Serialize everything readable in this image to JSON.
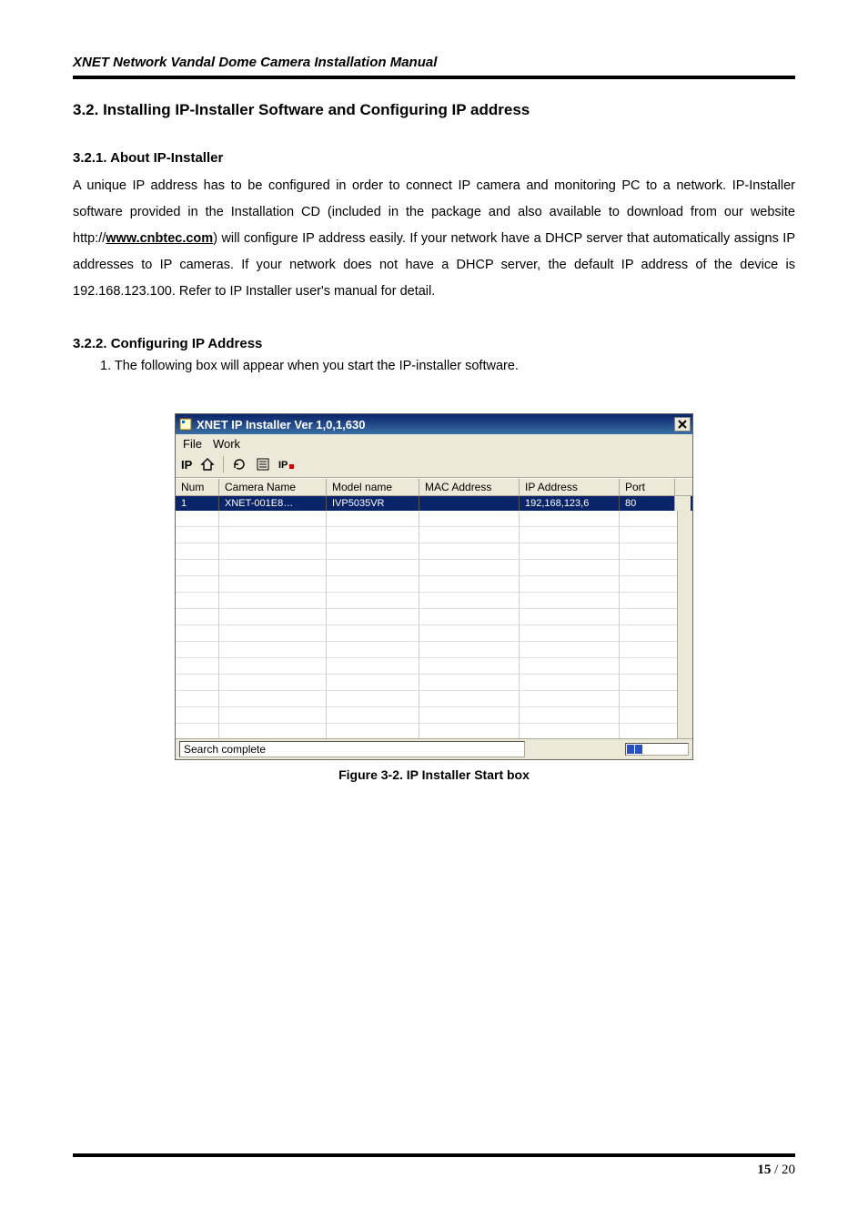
{
  "doc": {
    "header": "XNET Network Vandal Dome Camera Installation Manual",
    "section_title": "3.2. Installing IP-Installer Software and Configuring IP address",
    "sub1_title": "3.2.1. About IP-Installer",
    "para1_pre": "A unique IP address has to be configured in order to connect IP camera and monitoring PC to a network. IP-Installer software provided in the Installation CD (included in the package and also available to download from our website http://",
    "para1_link": "www.cnbtec.com",
    "para1_post": ") will configure IP address easily. If your network have a DHCP server that automatically assigns IP addresses to IP cameras. If your network does not have a DHCP server, the default IP address of the device is 192.168.123.100. Refer to IP Installer user's manual for detail.",
    "sub2_title": "3.2.2. Configuring IP Address",
    "step1": "1. The following box will appear when you start the IP-installer software.",
    "figure_caption": "Figure 3-2. IP Installer Start box",
    "page_current": "15",
    "page_sep": " / ",
    "page_total": "20"
  },
  "app": {
    "title": "XNET IP Installer Ver 1,0,1,630",
    "menu": {
      "file": "File",
      "work": "Work"
    },
    "toolbar": {
      "ip_label": "IP"
    },
    "columns": {
      "num": "Num",
      "camera": "Camera Name",
      "model": "Model name",
      "mac": "MAC Address",
      "ip": "IP Address",
      "port": "Port"
    },
    "row": {
      "num": "1",
      "camera": "XNET-001E8…",
      "model": "IVP5035VR",
      "mac": "",
      "ip": "192,168,123,6",
      "port": "80"
    },
    "status": "Search complete"
  }
}
